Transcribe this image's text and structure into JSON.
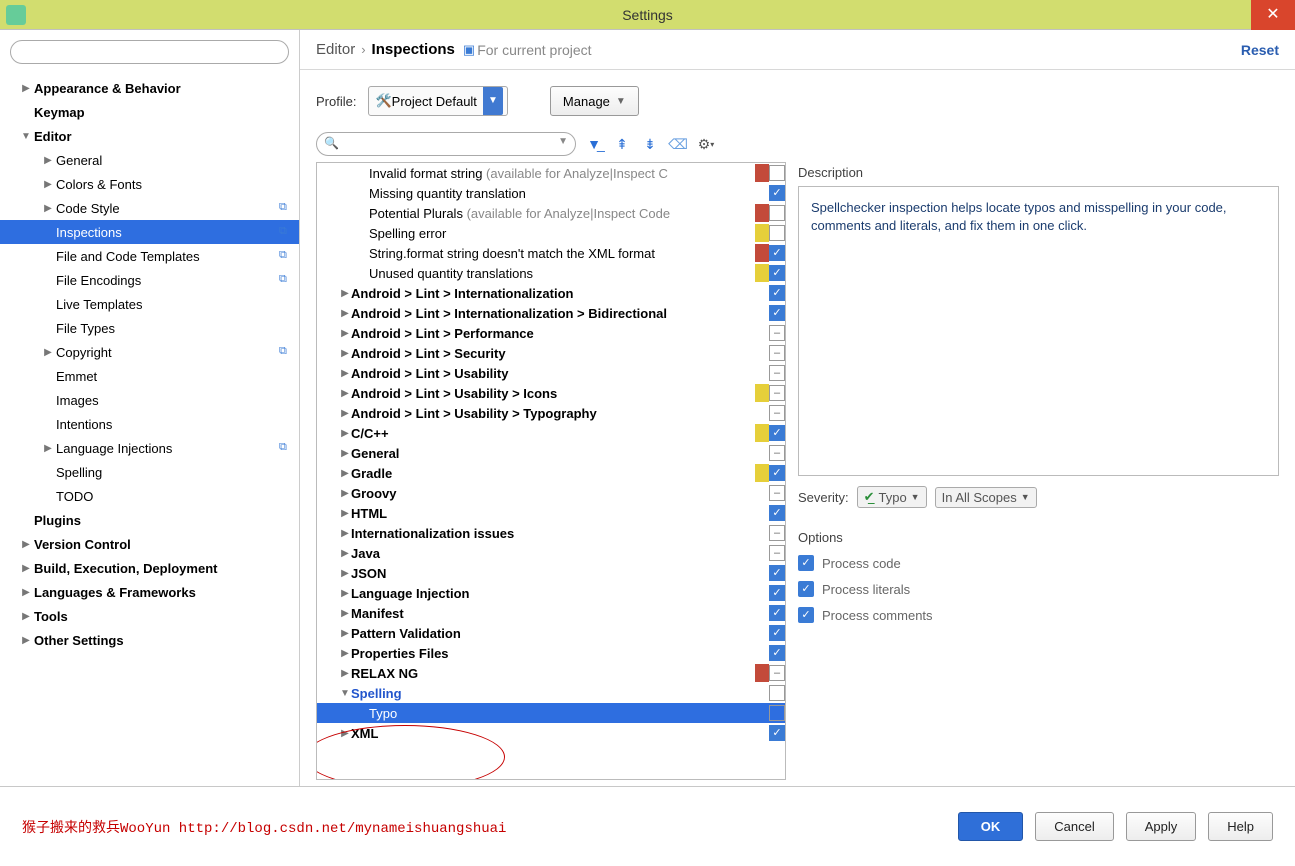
{
  "window": {
    "title": "Settings",
    "close": "✕"
  },
  "breadcrumb": {
    "a": "Editor",
    "b": "Inspections",
    "note": "For current project",
    "reset": "Reset"
  },
  "profile": {
    "label": "Profile:",
    "value": "Project Default",
    "manage": "Manage"
  },
  "sidebar": {
    "items": [
      {
        "label": "Appearance & Behavior",
        "indent": 0,
        "arrow": "▶",
        "bold": true
      },
      {
        "label": "Keymap",
        "indent": 0,
        "arrow": "",
        "bold": true
      },
      {
        "label": "Editor",
        "indent": 0,
        "arrow": "▼",
        "bold": true
      },
      {
        "label": "General",
        "indent": 1,
        "arrow": "▶"
      },
      {
        "label": "Colors & Fonts",
        "indent": 1,
        "arrow": "▶"
      },
      {
        "label": "Code Style",
        "indent": 1,
        "arrow": "▶",
        "copy": true
      },
      {
        "label": "Inspections",
        "indent": 1,
        "arrow": "",
        "selected": true,
        "copy": true
      },
      {
        "label": "File and Code Templates",
        "indent": 1,
        "arrow": "",
        "copy": true
      },
      {
        "label": "File Encodings",
        "indent": 1,
        "arrow": "",
        "copy": true
      },
      {
        "label": "Live Templates",
        "indent": 1,
        "arrow": ""
      },
      {
        "label": "File Types",
        "indent": 1,
        "arrow": ""
      },
      {
        "label": "Copyright",
        "indent": 1,
        "arrow": "▶",
        "copy": true
      },
      {
        "label": "Emmet",
        "indent": 1,
        "arrow": ""
      },
      {
        "label": "Images",
        "indent": 1,
        "arrow": ""
      },
      {
        "label": "Intentions",
        "indent": 1,
        "arrow": ""
      },
      {
        "label": "Language Injections",
        "indent": 1,
        "arrow": "▶",
        "copy": true
      },
      {
        "label": "Spelling",
        "indent": 1,
        "arrow": ""
      },
      {
        "label": "TODO",
        "indent": 1,
        "arrow": ""
      },
      {
        "label": "Plugins",
        "indent": 0,
        "arrow": "",
        "bold": true
      },
      {
        "label": "Version Control",
        "indent": 0,
        "arrow": "▶",
        "bold": true
      },
      {
        "label": "Build, Execution, Deployment",
        "indent": 0,
        "arrow": "▶",
        "bold": true
      },
      {
        "label": "Languages & Frameworks",
        "indent": 0,
        "arrow": "▶",
        "bold": true
      },
      {
        "label": "Tools",
        "indent": 0,
        "arrow": "▶",
        "bold": true
      },
      {
        "label": "Other Settings",
        "indent": 0,
        "arrow": "▶",
        "bold": true
      }
    ]
  },
  "inspections": {
    "items": [
      {
        "label": "Invalid format string",
        "gray": "(available for Analyze|Inspect C",
        "indent": 2,
        "warn": "red",
        "chk": "blank"
      },
      {
        "label": "Missing quantity translation",
        "indent": 2,
        "warn": "",
        "chk": "on"
      },
      {
        "label": "Potential Plurals",
        "gray": "(available for Analyze|Inspect Code",
        "indent": 2,
        "warn": "red",
        "chk": "blank"
      },
      {
        "label": "Spelling error",
        "indent": 2,
        "warn": "yel",
        "chk": "blank"
      },
      {
        "label": "String.format string doesn't match the XML format",
        "indent": 2,
        "warn": "red",
        "chk": "on"
      },
      {
        "label": "Unused quantity translations",
        "indent": 2,
        "warn": "yel",
        "chk": "on"
      },
      {
        "label": "Android > Lint > Internationalization",
        "indent": 1,
        "arrow": "▶",
        "bold": true,
        "chk": "on"
      },
      {
        "label": "Android > Lint > Internationalization > Bidirectional",
        "indent": 1,
        "arrow": "▶",
        "bold": true,
        "chk": "on"
      },
      {
        "label": "Android > Lint > Performance",
        "indent": 1,
        "arrow": "▶",
        "bold": true,
        "chk": "dash"
      },
      {
        "label": "Android > Lint > Security",
        "indent": 1,
        "arrow": "▶",
        "bold": true,
        "chk": "dash"
      },
      {
        "label": "Android > Lint > Usability",
        "indent": 1,
        "arrow": "▶",
        "bold": true,
        "chk": "dash"
      },
      {
        "label": "Android > Lint > Usability > Icons",
        "indent": 1,
        "arrow": "▶",
        "bold": true,
        "warn": "yel",
        "chk": "dash"
      },
      {
        "label": "Android > Lint > Usability > Typography",
        "indent": 1,
        "arrow": "▶",
        "bold": true,
        "chk": "dash"
      },
      {
        "label": "C/C++",
        "indent": 1,
        "arrow": "▶",
        "bold": true,
        "warn": "yel",
        "chk": "on"
      },
      {
        "label": "General",
        "indent": 1,
        "arrow": "▶",
        "bold": true,
        "chk": "dash"
      },
      {
        "label": "Gradle",
        "indent": 1,
        "arrow": "▶",
        "bold": true,
        "warn": "yel",
        "chk": "on"
      },
      {
        "label": "Groovy",
        "indent": 1,
        "arrow": "▶",
        "bold": true,
        "chk": "dash"
      },
      {
        "label": "HTML",
        "indent": 1,
        "arrow": "▶",
        "bold": true,
        "chk": "on"
      },
      {
        "label": "Internationalization issues",
        "indent": 1,
        "arrow": "▶",
        "bold": true,
        "chk": "dash"
      },
      {
        "label": "Java",
        "indent": 1,
        "arrow": "▶",
        "bold": true,
        "chk": "dash"
      },
      {
        "label": "JSON",
        "indent": 1,
        "arrow": "▶",
        "bold": true,
        "chk": "on"
      },
      {
        "label": "Language Injection",
        "indent": 1,
        "arrow": "▶",
        "bold": true,
        "chk": "on"
      },
      {
        "label": "Manifest",
        "indent": 1,
        "arrow": "▶",
        "bold": true,
        "chk": "on"
      },
      {
        "label": "Pattern Validation",
        "indent": 1,
        "arrow": "▶",
        "bold": true,
        "chk": "on"
      },
      {
        "label": "Properties Files",
        "indent": 1,
        "arrow": "▶",
        "bold": true,
        "chk": "on"
      },
      {
        "label": "RELAX NG",
        "indent": 1,
        "arrow": "▶",
        "bold": true,
        "warn": "red",
        "chk": "dash"
      },
      {
        "label": "Spelling",
        "indent": 1,
        "arrow": "▼",
        "blue": true,
        "chk": "blank"
      },
      {
        "label": "Typo",
        "indent": 2,
        "selected": true,
        "chk": "blank"
      },
      {
        "label": "XML",
        "indent": 1,
        "arrow": "▶",
        "bold": true,
        "chk": "on"
      }
    ]
  },
  "detail": {
    "desc_title": "Description",
    "desc": "Spellchecker inspection helps locate typos and misspelling in your code, comments and literals, and fix them in one click.",
    "severity_label": "Severity:",
    "severity_value": "Typo",
    "scope_value": "In All Scopes",
    "options_title": "Options",
    "opts": [
      "Process code",
      "Process literals",
      "Process comments"
    ]
  },
  "footer": {
    "note": "猴子搬来的救兵WooYun http://blog.csdn.net/mynameishuangshuai",
    "ok": "OK",
    "cancel": "Cancel",
    "apply": "Apply",
    "help": "Help"
  }
}
